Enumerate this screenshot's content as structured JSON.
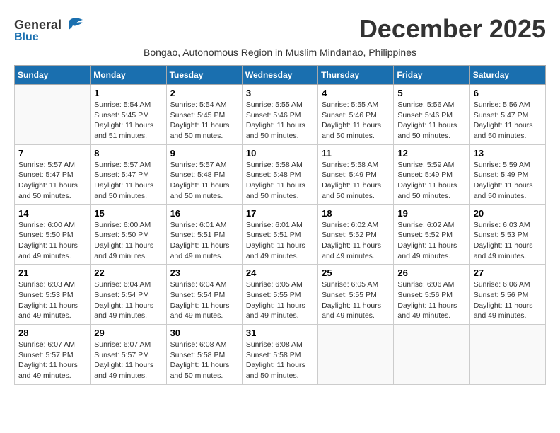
{
  "header": {
    "logo_general": "General",
    "logo_blue": "Blue",
    "title": "December 2025",
    "subtitle": "Bongao, Autonomous Region in Muslim Mindanao, Philippines"
  },
  "calendar": {
    "weekdays": [
      "Sunday",
      "Monday",
      "Tuesday",
      "Wednesday",
      "Thursday",
      "Friday",
      "Saturday"
    ],
    "weeks": [
      [
        {
          "day": "",
          "info": ""
        },
        {
          "day": "1",
          "info": "Sunrise: 5:54 AM\nSunset: 5:45 PM\nDaylight: 11 hours\nand 51 minutes."
        },
        {
          "day": "2",
          "info": "Sunrise: 5:54 AM\nSunset: 5:45 PM\nDaylight: 11 hours\nand 50 minutes."
        },
        {
          "day": "3",
          "info": "Sunrise: 5:55 AM\nSunset: 5:46 PM\nDaylight: 11 hours\nand 50 minutes."
        },
        {
          "day": "4",
          "info": "Sunrise: 5:55 AM\nSunset: 5:46 PM\nDaylight: 11 hours\nand 50 minutes."
        },
        {
          "day": "5",
          "info": "Sunrise: 5:56 AM\nSunset: 5:46 PM\nDaylight: 11 hours\nand 50 minutes."
        },
        {
          "day": "6",
          "info": "Sunrise: 5:56 AM\nSunset: 5:47 PM\nDaylight: 11 hours\nand 50 minutes."
        }
      ],
      [
        {
          "day": "7",
          "info": "Sunrise: 5:57 AM\nSunset: 5:47 PM\nDaylight: 11 hours\nand 50 minutes."
        },
        {
          "day": "8",
          "info": "Sunrise: 5:57 AM\nSunset: 5:47 PM\nDaylight: 11 hours\nand 50 minutes."
        },
        {
          "day": "9",
          "info": "Sunrise: 5:57 AM\nSunset: 5:48 PM\nDaylight: 11 hours\nand 50 minutes."
        },
        {
          "day": "10",
          "info": "Sunrise: 5:58 AM\nSunset: 5:48 PM\nDaylight: 11 hours\nand 50 minutes."
        },
        {
          "day": "11",
          "info": "Sunrise: 5:58 AM\nSunset: 5:49 PM\nDaylight: 11 hours\nand 50 minutes."
        },
        {
          "day": "12",
          "info": "Sunrise: 5:59 AM\nSunset: 5:49 PM\nDaylight: 11 hours\nand 50 minutes."
        },
        {
          "day": "13",
          "info": "Sunrise: 5:59 AM\nSunset: 5:49 PM\nDaylight: 11 hours\nand 50 minutes."
        }
      ],
      [
        {
          "day": "14",
          "info": "Sunrise: 6:00 AM\nSunset: 5:50 PM\nDaylight: 11 hours\nand 49 minutes."
        },
        {
          "day": "15",
          "info": "Sunrise: 6:00 AM\nSunset: 5:50 PM\nDaylight: 11 hours\nand 49 minutes."
        },
        {
          "day": "16",
          "info": "Sunrise: 6:01 AM\nSunset: 5:51 PM\nDaylight: 11 hours\nand 49 minutes."
        },
        {
          "day": "17",
          "info": "Sunrise: 6:01 AM\nSunset: 5:51 PM\nDaylight: 11 hours\nand 49 minutes."
        },
        {
          "day": "18",
          "info": "Sunrise: 6:02 AM\nSunset: 5:52 PM\nDaylight: 11 hours\nand 49 minutes."
        },
        {
          "day": "19",
          "info": "Sunrise: 6:02 AM\nSunset: 5:52 PM\nDaylight: 11 hours\nand 49 minutes."
        },
        {
          "day": "20",
          "info": "Sunrise: 6:03 AM\nSunset: 5:53 PM\nDaylight: 11 hours\nand 49 minutes."
        }
      ],
      [
        {
          "day": "21",
          "info": "Sunrise: 6:03 AM\nSunset: 5:53 PM\nDaylight: 11 hours\nand 49 minutes."
        },
        {
          "day": "22",
          "info": "Sunrise: 6:04 AM\nSunset: 5:54 PM\nDaylight: 11 hours\nand 49 minutes."
        },
        {
          "day": "23",
          "info": "Sunrise: 6:04 AM\nSunset: 5:54 PM\nDaylight: 11 hours\nand 49 minutes."
        },
        {
          "day": "24",
          "info": "Sunrise: 6:05 AM\nSunset: 5:55 PM\nDaylight: 11 hours\nand 49 minutes."
        },
        {
          "day": "25",
          "info": "Sunrise: 6:05 AM\nSunset: 5:55 PM\nDaylight: 11 hours\nand 49 minutes."
        },
        {
          "day": "26",
          "info": "Sunrise: 6:06 AM\nSunset: 5:56 PM\nDaylight: 11 hours\nand 49 minutes."
        },
        {
          "day": "27",
          "info": "Sunrise: 6:06 AM\nSunset: 5:56 PM\nDaylight: 11 hours\nand 49 minutes."
        }
      ],
      [
        {
          "day": "28",
          "info": "Sunrise: 6:07 AM\nSunset: 5:57 PM\nDaylight: 11 hours\nand 49 minutes."
        },
        {
          "day": "29",
          "info": "Sunrise: 6:07 AM\nSunset: 5:57 PM\nDaylight: 11 hours\nand 49 minutes."
        },
        {
          "day": "30",
          "info": "Sunrise: 6:08 AM\nSunset: 5:58 PM\nDaylight: 11 hours\nand 50 minutes."
        },
        {
          "day": "31",
          "info": "Sunrise: 6:08 AM\nSunset: 5:58 PM\nDaylight: 11 hours\nand 50 minutes."
        },
        {
          "day": "",
          "info": ""
        },
        {
          "day": "",
          "info": ""
        },
        {
          "day": "",
          "info": ""
        }
      ]
    ]
  }
}
